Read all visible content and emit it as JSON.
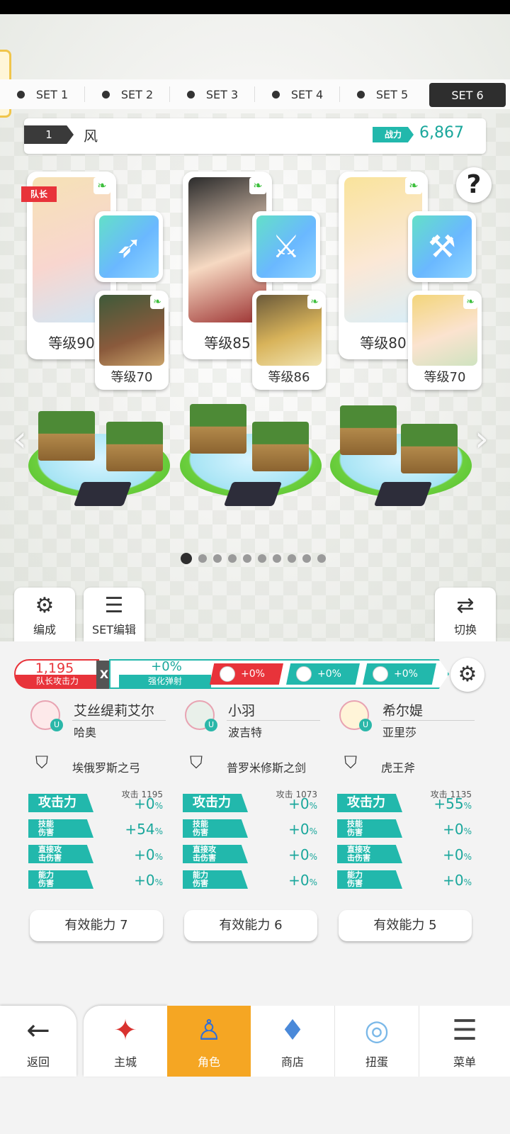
{
  "set_tabs": [
    "SET 1",
    "SET 2",
    "SET 3",
    "SET 4",
    "SET 5",
    "SET 6"
  ],
  "active_set": "SET 6",
  "team": {
    "number": "1",
    "name": "风",
    "power_label": "战力",
    "power_value": "6,867"
  },
  "help_label": "?",
  "leader_tag": "队长",
  "heroes": [
    {
      "level": "等级90",
      "sub_level": "等级70",
      "weapon_icon": "bow-icon"
    },
    {
      "level": "等级85",
      "sub_level": "等级86",
      "weapon_icon": "sword-icon"
    },
    {
      "level": "等级80",
      "sub_level": "等级70",
      "weapon_icon": "axe-icon"
    }
  ],
  "nav_arrows": {
    "left": "‹",
    "right": "›"
  },
  "page_dot_count": 10,
  "scene_buttons": {
    "compose": "编成",
    "set_edit": "SET编辑",
    "switch": "切换"
  },
  "summary": {
    "leader_atk_value": "1,195",
    "leader_atk_label": "队长攻击力",
    "x_label": "X",
    "bounce_value": "+0%",
    "bounce_label": "强化弹射",
    "chips": [
      "+0%",
      "+0%",
      "+0%"
    ],
    "chip_colors": [
      "#e8333a",
      "#22b8ac",
      "#22b8ac"
    ]
  },
  "hero_details": [
    {
      "name": "艾丝缇莉艾尔",
      "sub": "哈奥",
      "weapon": "埃俄罗斯之弓",
      "atk_note": "攻击 1195",
      "stats": [
        {
          "label": "攻击力",
          "value": "+0",
          "unit": "%"
        },
        {
          "label": "技能\n伤害",
          "value": "+54",
          "unit": "%"
        },
        {
          "label": "直接攻\n击伤害",
          "value": "+0",
          "unit": "%"
        },
        {
          "label": "能力\n伤害",
          "value": "+0",
          "unit": "%"
        }
      ],
      "effective": "有效能力 7"
    },
    {
      "name": "小羽",
      "sub": "波吉特",
      "weapon": "普罗米修斯之剑",
      "atk_note": "攻击 1073",
      "stats": [
        {
          "label": "攻击力",
          "value": "+0",
          "unit": "%"
        },
        {
          "label": "技能\n伤害",
          "value": "+0",
          "unit": "%"
        },
        {
          "label": "直接攻\n击伤害",
          "value": "+0",
          "unit": "%"
        },
        {
          "label": "能力\n伤害",
          "value": "+0",
          "unit": "%"
        }
      ],
      "effective": "有效能力 6"
    },
    {
      "name": "希尔媞",
      "sub": "亚里莎",
      "weapon": "虎王斧",
      "atk_note": "攻击 1135",
      "stats": [
        {
          "label": "攻击力",
          "value": "+55",
          "unit": "%"
        },
        {
          "label": "技能\n伤害",
          "value": "+0",
          "unit": "%"
        },
        {
          "label": "直接攻\n击伤害",
          "value": "+0",
          "unit": "%"
        },
        {
          "label": "能力\n伤害",
          "value": "+0",
          "unit": "%"
        }
      ],
      "effective": "有效能力 5"
    }
  ],
  "bottom_nav": [
    {
      "label": "返回",
      "icon": "back-arrow-icon",
      "glyph": "←"
    },
    {
      "label": "主城",
      "icon": "castle-icon",
      "glyph": "✦"
    },
    {
      "label": "角色",
      "icon": "character-icon",
      "glyph": "♙"
    },
    {
      "label": "商店",
      "icon": "shop-bag-icon",
      "glyph": "♦"
    },
    {
      "label": "扭蛋",
      "icon": "gacha-icon",
      "glyph": "◎"
    },
    {
      "label": "菜单",
      "icon": "menu-list-icon",
      "glyph": "☰"
    }
  ],
  "active_nav": "角色",
  "colors": {
    "accent_teal": "#22b8ac",
    "accent_red": "#e8333a",
    "active_nav": "#f5a623"
  }
}
